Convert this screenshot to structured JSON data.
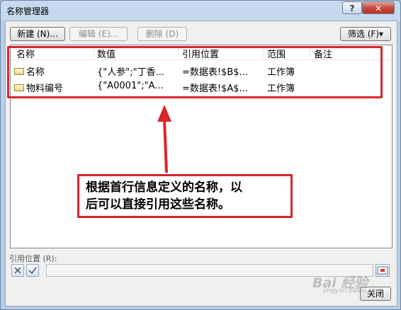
{
  "window": {
    "title": "名称管理器",
    "help_label": "?",
    "close_label": "✕"
  },
  "toolbar": {
    "new_label": "新建 (N)...",
    "edit_label": "编辑 (E)...",
    "delete_label": "删除 (D)",
    "filter_label": "筛选 (F)▾"
  },
  "list": {
    "columns": [
      "名称",
      "数值",
      "引用位置",
      "范围",
      "备注"
    ],
    "rows": [
      {
        "name": "名称",
        "value": "{\"人参\";\"丁香...",
        "refers_to": "=数据表!$B$...",
        "scope": "工作簿",
        "comment": ""
      },
      {
        "name": "物料编号",
        "value": "{\"A0001\";\"A...",
        "refers_to": "=数据表!$A$...",
        "scope": "工作簿",
        "comment": ""
      }
    ]
  },
  "annotation": {
    "line1": "根据首行信息定义的名称，以",
    "line2": "后可以直接引用这些名称。",
    "color": "#d9262c"
  },
  "reference": {
    "label": "引用位置 (R):",
    "value": ""
  },
  "footer": {
    "close_label": "关闭"
  },
  "watermark": {
    "text": "Bai 经验",
    "sub": "jingyan.baidu.com"
  }
}
